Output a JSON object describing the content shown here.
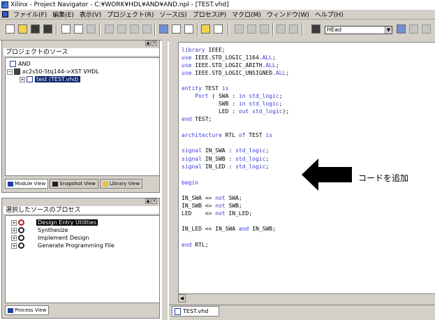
{
  "window": {
    "title": "Xilinx - Project Navigator - C:¥WORK¥HDL¥AND¥AND.npl - [TEST.vhd]"
  },
  "menu": [
    "ファイル(F)",
    "編集(E)",
    "表示(V)",
    "プロジェクト(R)",
    "ソース(S)",
    "プロセス(P)",
    "マクロ(M)",
    "ウィンドウ(W)",
    "ヘルプ(H)"
  ],
  "toolbar": {
    "combo_value": "HEad"
  },
  "sources_panel": {
    "title": "プロジェクトのソース",
    "tree": {
      "project": "AND",
      "device": "xc2s50-5tq144->XST VHDL",
      "file": "test (TEST.vhd)"
    },
    "tabs": [
      "Module View",
      "Snapshot View",
      "Library View"
    ]
  },
  "process_panel": {
    "title": "選択したソースのプロセス",
    "items": [
      "Design Entry Utilities",
      "Synthesize",
      "Implement Design",
      "Generate Programming File"
    ],
    "tab": "Process View"
  },
  "editor": {
    "lines": [
      [
        "",
        "library IEEE;"
      ],
      [
        "use IEEE.STD_LOGIC_1164.ALL;"
      ],
      [
        "use IEEE.STD_LOGIC_ARITH.ALL;"
      ],
      [
        "use IEEE.STD_LOGIC_UNSIGNED.ALL;"
      ]
    ],
    "code": {
      "l1": "library IEEE;",
      "l2": "use IEEE.STD_LOGIC_1164.ALL;",
      "l3": "use IEEE.STD_LOGIC_ARITH.ALL;",
      "l4": "use IEEE.STD_LOGIC_UNSIGNED.ALL;",
      "l5": "entity TEST is",
      "l6": "    Port ( SWA : in std_logic;",
      "l7": "           SWB : in std_logic;",
      "l8": "           LED : out std_logic);",
      "l9": "end TEST;",
      "l10": "architecture RTL of TEST is",
      "l11": "signal IN_SWA : std_logic;",
      "l12": "signal IN_SWB : std_logic;",
      "l13": "signal IN_LED : std_logic;",
      "l14": "begin",
      "l15": "IN_SWA <= not SWA;",
      "l16": "IN_SWB <= not SWB;",
      "l17": "LED    <= not IN_LED;",
      "l18": "IN_LED <= IN_SWA and IN_SWB;",
      "l19": "end RTL;"
    },
    "file_tab": "TEST.vhd"
  },
  "annotation": {
    "text": "コードを追加"
  }
}
